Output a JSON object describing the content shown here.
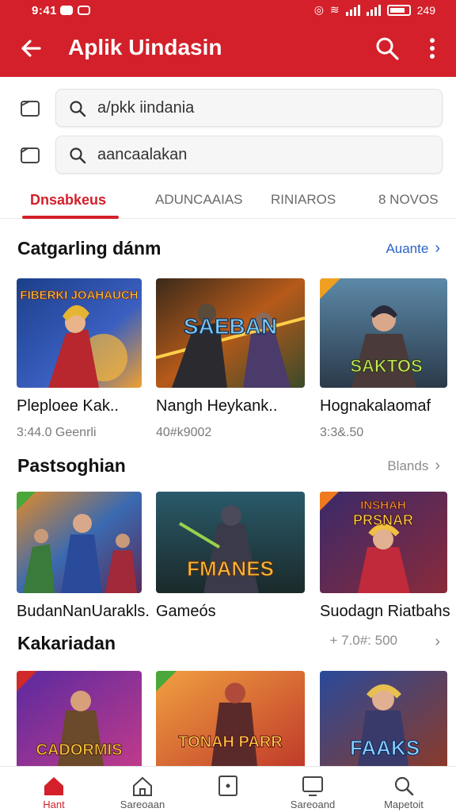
{
  "status": {
    "time": "9:41",
    "right_text": "249"
  },
  "appbar": {
    "title": "Aplik Uindasin"
  },
  "search_rows": [
    {
      "value": "a/pkk iindania"
    },
    {
      "value": "aancaalakan"
    }
  ],
  "tabs": [
    {
      "label": "Dnsabkeus",
      "active": true
    },
    {
      "label": "ADUNCAAIAS"
    },
    {
      "label": "RINIAROS"
    },
    {
      "label": "8 NOVOS"
    }
  ],
  "sections": [
    {
      "title": "Catgarling dánm",
      "more_label": "Auante",
      "cards": [
        {
          "art_text": "FIBERKI JOAHAUCH",
          "name": "Pleploee Kak..",
          "meta": "3:44.0 Geenrli"
        },
        {
          "art_text": "SAEBAN",
          "name": "Nangh Heykank..",
          "meta": "40#k9002"
        },
        {
          "art_text": "SAKTOS",
          "name": "Hognakalaomaf",
          "meta": "3:3&.50"
        }
      ]
    },
    {
      "title": "Pastsoghian",
      "more_label": "Blands",
      "cards": [
        {
          "art_text": "",
          "name": "BudanNanUarakls.",
          "meta": ""
        },
        {
          "art_text": "FMANES",
          "name": "Gameós",
          "meta": ""
        },
        {
          "art_text": "INSHAH PRSNAR",
          "name": "Suodagn Riatbahs",
          "meta": ""
        }
      ]
    },
    {
      "title": "Kakariadan",
      "more_label": "+ 7.0#: 500",
      "cards": [
        {
          "art_text": "CADORMIS",
          "name": "",
          "meta": ""
        },
        {
          "art_text": "TONAH PARR",
          "name": "",
          "meta": ""
        },
        {
          "art_text": "FAAKS",
          "name": "",
          "meta": ""
        }
      ]
    }
  ],
  "bottom_nav": [
    {
      "label": "Hant",
      "icon": "home-icon",
      "active": true
    },
    {
      "label": "Sareoaan",
      "icon": "store-icon"
    },
    {
      "label": "",
      "icon": "box-icon"
    },
    {
      "label": "Sareoand",
      "icon": "monitor-icon"
    },
    {
      "label": "Mapetoit",
      "icon": "search-icon"
    }
  ],
  "colors": {
    "brand": "#d3202a",
    "link": "#2a63c8"
  }
}
